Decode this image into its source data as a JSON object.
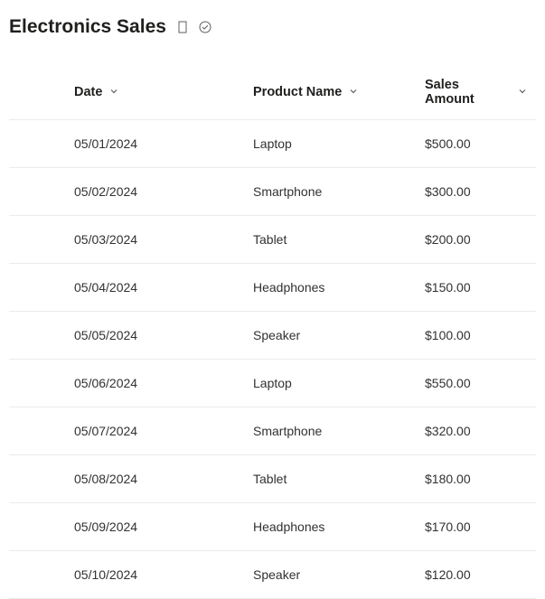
{
  "header": {
    "title": "Electronics Sales"
  },
  "table": {
    "columns": {
      "date": "Date",
      "product": "Product Name",
      "amount": "Sales Amount"
    },
    "rows": [
      {
        "date": "05/01/2024",
        "product": "Laptop",
        "amount": "$500.00"
      },
      {
        "date": "05/02/2024",
        "product": "Smartphone",
        "amount": "$300.00"
      },
      {
        "date": "05/03/2024",
        "product": "Tablet",
        "amount": "$200.00"
      },
      {
        "date": "05/04/2024",
        "product": "Headphones",
        "amount": "$150.00"
      },
      {
        "date": "05/05/2024",
        "product": "Speaker",
        "amount": "$100.00"
      },
      {
        "date": "05/06/2024",
        "product": "Laptop",
        "amount": "$550.00"
      },
      {
        "date": "05/07/2024",
        "product": "Smartphone",
        "amount": "$320.00"
      },
      {
        "date": "05/08/2024",
        "product": "Tablet",
        "amount": "$180.00"
      },
      {
        "date": "05/09/2024",
        "product": "Headphones",
        "amount": "$170.00"
      },
      {
        "date": "05/10/2024",
        "product": "Speaker",
        "amount": "$120.00"
      }
    ]
  }
}
